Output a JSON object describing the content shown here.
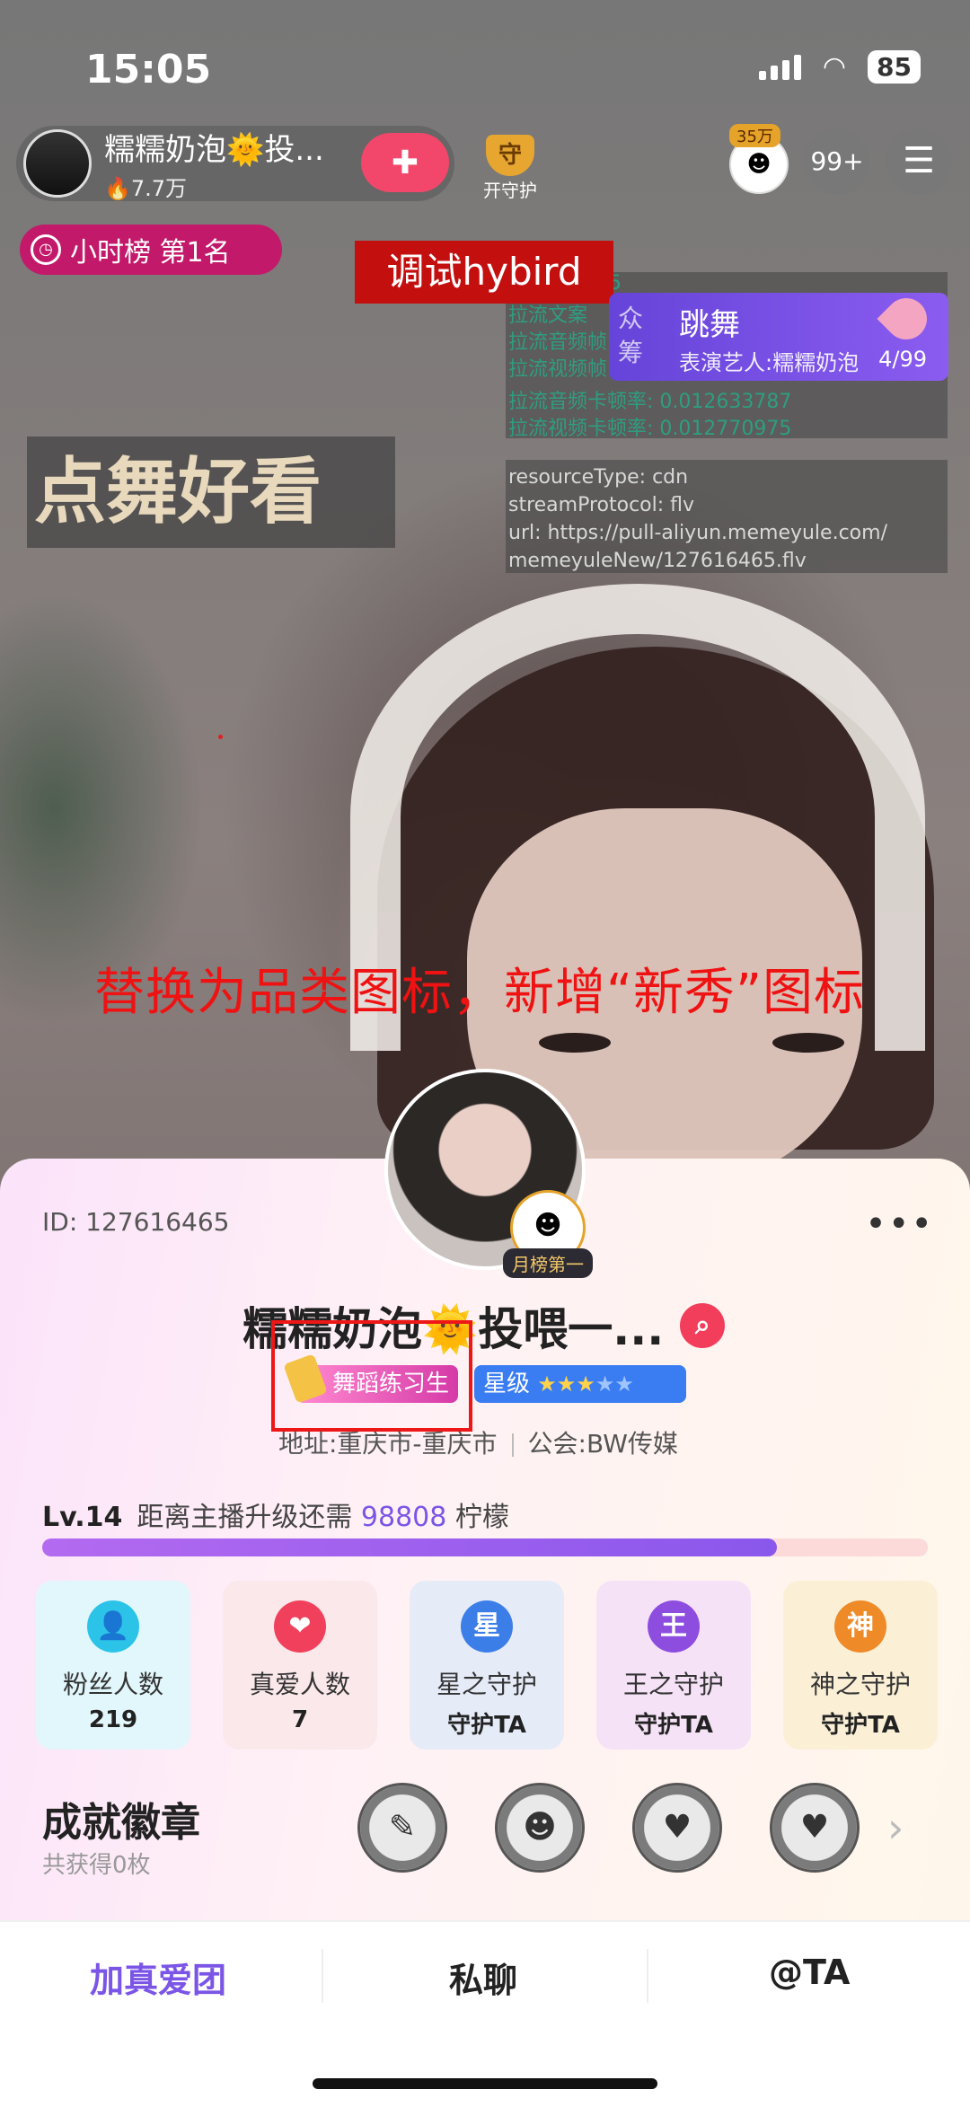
{
  "status": {
    "time": "15:05",
    "battery": "85"
  },
  "anchor": {
    "name": "糯糯奶泡🌞投...",
    "heat": "🔥7.7万",
    "follow_icon": "heart-plus-icon"
  },
  "guard": {
    "label": "开守护",
    "shield_text": "守"
  },
  "viewer_badge": "35万",
  "viewer_count": "99+",
  "rank": {
    "label": "小时榜 第1名"
  },
  "debug": {
    "button": "调试hybird",
    "lines": [
      "127616465",
      "拉流文案",
      "拉流音频帧",
      "拉流视频帧",
      "拉流音频卡顿率: 0.012633787",
      "拉流视频卡顿率: 0.012770975"
    ],
    "info": [
      "resourceType: cdn",
      "streamProtocol: flv",
      "url: https://pull-aliyun.memeyule.com/",
      "memeyuleNew/127616465.flv"
    ]
  },
  "dance_card": {
    "tag": "众筹",
    "title": "跳舞",
    "subtitle": "表演艺人:糯糯奶泡",
    "count": "4/99"
  },
  "banner": "点舞好看",
  "annotation": "替换为品类图标，新增“新秀”图标",
  "profile": {
    "id": "ID: 127616465",
    "name": "糯糯奶泡🌞投喂一...",
    "month_badge": "月榜第一",
    "tag_dance": "舞蹈练习生",
    "tag_star_label": "星级",
    "stars_on": "★★★",
    "stars_off": "★★",
    "location": "地址:重庆市-重庆市",
    "guild": "公会:BW传媒",
    "level": "Lv.14",
    "level_text": "距离主播升级还需",
    "level_num": "98808",
    "level_unit": "柠檬",
    "progress": 0.83
  },
  "stats": [
    {
      "label": "粉丝人数",
      "value": "219",
      "icon": "user-icon",
      "icon_text": "👤"
    },
    {
      "label": "真爱人数",
      "value": "7",
      "icon": "heart-icon",
      "icon_text": "❤"
    },
    {
      "label": "星之守护",
      "value": "守护TA",
      "icon": "star-guard-icon",
      "icon_text": "星"
    },
    {
      "label": "王之守护",
      "value": "守护TA",
      "icon": "king-guard-icon",
      "icon_text": "王"
    },
    {
      "label": "神之守护",
      "value": "守护TA",
      "icon": "god-guard-icon",
      "icon_text": "神"
    }
  ],
  "badges": {
    "title": "成就徽章",
    "subtitle": "共获得0枚",
    "medals": [
      "✎",
      "☻",
      "♥",
      "♥"
    ]
  },
  "bottom": {
    "join": "加真爱团",
    "chat": "私聊",
    "at": "@TA"
  },
  "colors": {
    "accent": "#7b55e6",
    "rank_pill": "#c3196a",
    "debug_red": "#c40f0f"
  }
}
